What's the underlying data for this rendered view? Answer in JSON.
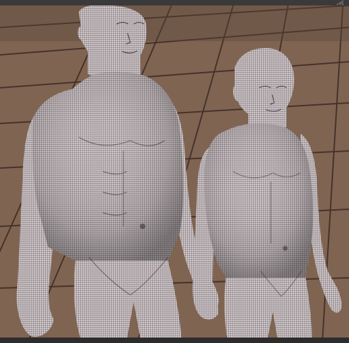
{
  "window": {
    "title": ""
  },
  "viewport": {
    "background_color": "#6b5444",
    "floor_color": "#8a6c58",
    "grid_line_color": "#3b2a22",
    "mesh_color": "#c9bfc2",
    "wire_color": "#2b2528"
  },
  "scene": {
    "objects": [
      {
        "name": "adult-male-figure",
        "kind": "wireframe mesh"
      },
      {
        "name": "teen-male-figure",
        "kind": "wireframe mesh"
      }
    ]
  },
  "icons": {
    "resize_handle": "resize-handle-icon"
  }
}
